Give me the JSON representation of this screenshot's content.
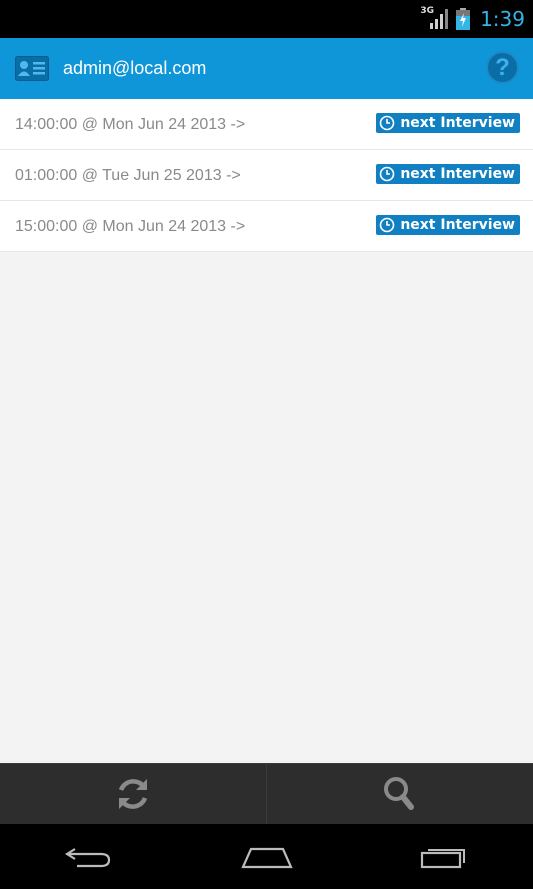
{
  "status_bar": {
    "network": "3G",
    "time": "1:39"
  },
  "header": {
    "account_email": "admin@local.com",
    "account_icon": "contact-card-icon",
    "help_icon": "help-icon",
    "help_symbol": "?"
  },
  "interviews": [
    {
      "text": "14:00:00 @ Mon Jun 24 2013 ->",
      "badge": "next Interview"
    },
    {
      "text": "01:00:00 @ Tue Jun 25 2013 ->",
      "badge": "next Interview"
    },
    {
      "text": "15:00:00 @ Mon Jun 24 2013 ->",
      "badge": "next Interview"
    }
  ],
  "action_bar": {
    "refresh_icon": "refresh-icon",
    "search_icon": "search-icon"
  },
  "nav_bar": {
    "back_icon": "back-icon",
    "home_icon": "home-icon",
    "recents_icon": "recent-apps-icon"
  },
  "colors": {
    "header_bg": "#0f96d8",
    "badge_bg": "#1080c3",
    "clock_accent": "#33b5e5",
    "list_text": "#8a8a8a"
  }
}
